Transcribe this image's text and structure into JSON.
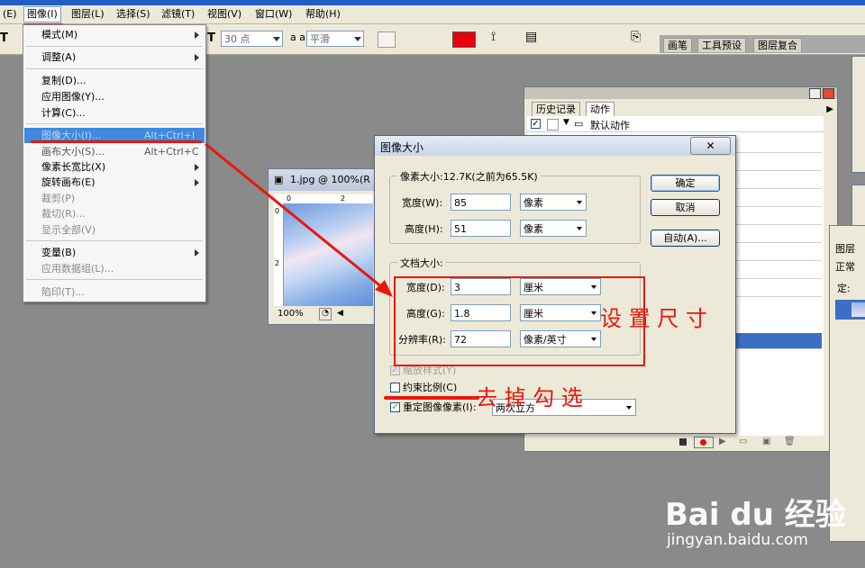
{
  "menubar": {
    "items": [
      {
        "label": "(E)",
        "active": false
      },
      {
        "label": "图像(I)",
        "active": true
      },
      {
        "label": "图层(L)",
        "active": false
      },
      {
        "label": "选择(S)",
        "active": false
      },
      {
        "label": "滤镜(T)",
        "active": false
      },
      {
        "label": "视图(V)",
        "active": false
      },
      {
        "label": "窗口(W)",
        "active": false
      },
      {
        "label": "帮助(H)",
        "active": false
      }
    ]
  },
  "options_bar": {
    "font_size": "30 点",
    "aa_label": "a a",
    "antialias": "平滑",
    "color": "#e8000c",
    "tabs": [
      "画笔",
      "工具预设",
      "图层复合"
    ]
  },
  "image_menu": {
    "items": [
      {
        "label": "模式(M)",
        "shortcut": "",
        "submenu": true,
        "disabled": false
      },
      {
        "label": "调整(A)",
        "shortcut": "",
        "submenu": true,
        "disabled": false
      },
      {
        "label": "复制(D)...",
        "shortcut": "",
        "submenu": false,
        "disabled": false
      },
      {
        "label": "应用图像(Y)...",
        "shortcut": "",
        "submenu": false,
        "disabled": false
      },
      {
        "label": "计算(C)...",
        "shortcut": "",
        "submenu": false,
        "disabled": false
      },
      {
        "label": "图像大小(I)...",
        "shortcut": "Alt+Ctrl+I",
        "submenu": false,
        "highlighted": true
      },
      {
        "label": "画布大小(S)...",
        "shortcut": "Alt+Ctrl+C",
        "submenu": false,
        "disabled": false
      },
      {
        "label": "像素长宽比(X)",
        "shortcut": "",
        "submenu": true,
        "disabled": false
      },
      {
        "label": "旋转画布(E)",
        "shortcut": "",
        "submenu": true,
        "disabled": false
      },
      {
        "label": "裁剪(P)",
        "shortcut": "",
        "submenu": false,
        "disabled": true
      },
      {
        "label": "裁切(R)...",
        "shortcut": "",
        "submenu": false,
        "disabled": false
      },
      {
        "label": "显示全部(V)",
        "shortcut": "",
        "submenu": false,
        "disabled": true
      },
      {
        "label": "变量(B)",
        "shortcut": "",
        "submenu": true,
        "disabled": false
      },
      {
        "label": "应用数据组(L)...",
        "shortcut": "",
        "submenu": false,
        "disabled": true
      },
      {
        "label": "陷印(T)...",
        "shortcut": "",
        "submenu": false,
        "disabled": true
      }
    ]
  },
  "history_panel": {
    "tabs": [
      "历史记录",
      "动作"
    ],
    "first_row": "默认动作"
  },
  "layers_panel": {
    "tab": "图层",
    "blend": "正常",
    "lock": "定:"
  },
  "document": {
    "title": "1.jpg @ 100%(R",
    "zoom": "100%",
    "ruler_top": [
      "0",
      "2"
    ],
    "ruler_left": [
      "0",
      "2"
    ]
  },
  "dialog": {
    "title": "图像大小",
    "pixel_group": "像素大小:12.7K(之前为65.5K)",
    "pixel_width_label": "宽度(W):",
    "pixel_width": "85",
    "pixel_width_unit": "像素",
    "pixel_height_label": "高度(H):",
    "pixel_height": "51",
    "pixel_height_unit": "像素",
    "doc_group": "文档大小:",
    "doc_width_label": "宽度(D):",
    "doc_width": "3",
    "doc_width_unit": "厘米",
    "doc_height_label": "高度(G):",
    "doc_height": "1.8",
    "doc_height_unit": "厘米",
    "res_label": "分辨率(R):",
    "resolution": "72",
    "res_unit": "像素/英寸",
    "scale_styles": "缩放样式(Y)",
    "constrain": "约束比例(C)",
    "resample": "重定图像像素(I):",
    "resample_method": "两次立方",
    "ok": "确定",
    "cancel": "取消",
    "auto": "自动(A)..."
  },
  "annotations": {
    "set_size": "设 置 尺 寸",
    "uncheck": "去 掉 勾 选"
  },
  "watermark": {
    "brand": "Bai du 经验",
    "url": "jingyan.baidu.com"
  }
}
